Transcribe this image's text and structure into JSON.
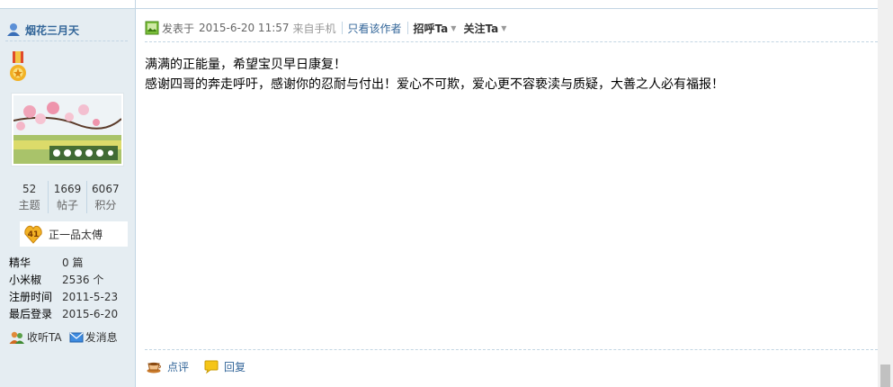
{
  "user": {
    "name": "烟花三月天",
    "stats": [
      {
        "num": "52",
        "label": "主题"
      },
      {
        "num": "1669",
        "label": "帖子"
      },
      {
        "num": "6067",
        "label": "积分"
      }
    ],
    "rank": {
      "level": "41",
      "title": "正一品太傅"
    },
    "info": [
      {
        "key": "精华",
        "value": "0 篇"
      },
      {
        "key": "小米椒",
        "value": "2536 个"
      },
      {
        "key": "注册时间",
        "value": "2011-5-23"
      },
      {
        "key": "最后登录",
        "value": "2015-6-20"
      }
    ],
    "actions": {
      "follow": "收听TA",
      "message": "发消息"
    }
  },
  "post": {
    "posted_prefix": "发表于",
    "posted_time": "2015-6-20 11:57",
    "source": "来自手机",
    "author_only": "只看该作者",
    "greet": "招呼Ta",
    "follow": "关注Ta",
    "lines": [
      "满满的正能量，希望宝贝早日康复！",
      "感谢四哥的奔走呼吁，感谢你的忍耐与付出！爱心不可欺，爱心更不容亵渎与质疑，大善之人必有福报！"
    ],
    "footer": {
      "comment": "点评",
      "reply": "回复"
    }
  },
  "colors": {
    "link": "#336699",
    "sidebar_bg": "#e5edf2",
    "border": "#c2d5e3"
  }
}
